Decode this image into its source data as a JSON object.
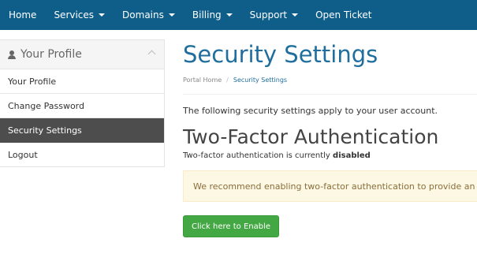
{
  "nav": {
    "items": [
      {
        "label": "Home",
        "dropdown": false
      },
      {
        "label": "Services",
        "dropdown": true
      },
      {
        "label": "Domains",
        "dropdown": true
      },
      {
        "label": "Billing",
        "dropdown": true
      },
      {
        "label": "Support",
        "dropdown": true
      },
      {
        "label": "Open Ticket",
        "dropdown": false
      }
    ]
  },
  "sidebar": {
    "header": "Your Profile",
    "items": [
      {
        "label": "Your Profile"
      },
      {
        "label": "Change Password"
      },
      {
        "label": "Security Settings",
        "active": true
      },
      {
        "label": "Logout"
      }
    ]
  },
  "main": {
    "title": "Security Settings",
    "breadcrumb": [
      "Portal Home",
      "Security Settings"
    ],
    "intro": "The following security settings apply to your user account.",
    "section_title": "Two-Factor Authentication",
    "status_prefix": "Two-factor authentication is currently",
    "status_value": "disabled",
    "alert": "We recommend enabling two-factor authentication to provide an ext",
    "enable_button": "Click here to Enable"
  },
  "colors": {
    "nav_bg": "#0f5e8a",
    "title": "#1f6e9d",
    "active_item": "#4d4d4d",
    "alert_bg": "#fcf8e3",
    "button": "#43a843"
  }
}
